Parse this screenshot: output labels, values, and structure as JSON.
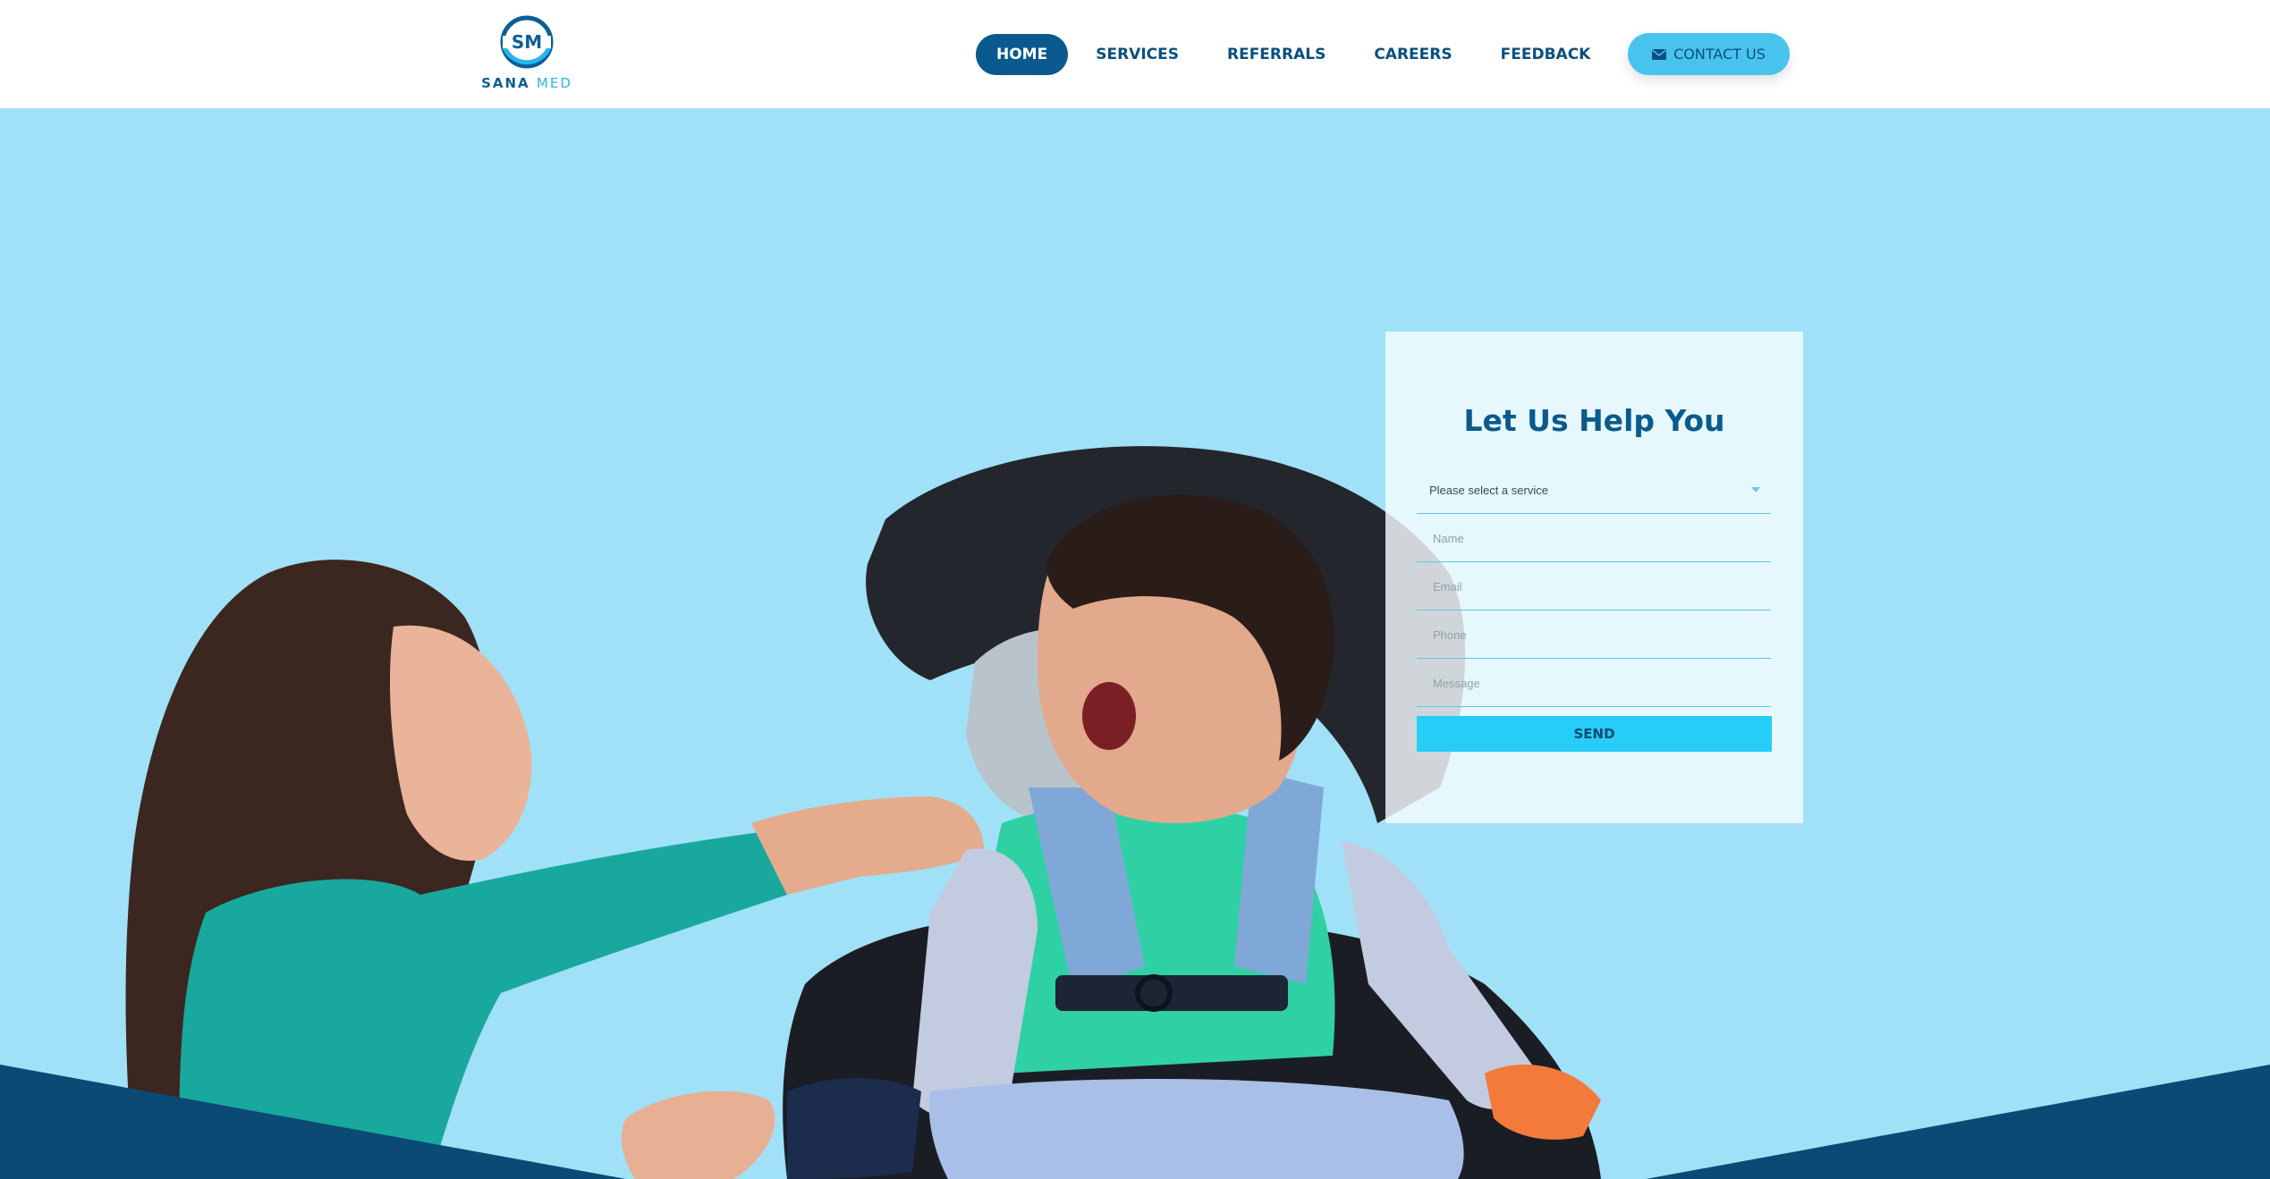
{
  "brand": {
    "logo_monogram": "SM",
    "name_primary": "SANA",
    "name_secondary": "MED"
  },
  "nav": {
    "items": [
      {
        "label": "HOME",
        "active": true
      },
      {
        "label": "SERVICES",
        "active": false
      },
      {
        "label": "REFERRALS",
        "active": false
      },
      {
        "label": "CAREERS",
        "active": false
      },
      {
        "label": "FEEDBACK",
        "active": false
      }
    ]
  },
  "header": {
    "contact_label": "CONTACT US",
    "contact_icon": "envelope-icon"
  },
  "form": {
    "title": "Let Us Help You",
    "service_select_value": "Please select a service",
    "name_placeholder": "Name",
    "email_placeholder": "Email",
    "phone_placeholder": "Phone",
    "message_placeholder": "Message",
    "send_label": "SEND"
  },
  "colors": {
    "hero_background": "#a0e1f7",
    "brand_dark": "#0a5a8f",
    "accent": "#26cdf6",
    "contact_button": "#47c3ee",
    "footer_wave": "#0a4a74"
  }
}
